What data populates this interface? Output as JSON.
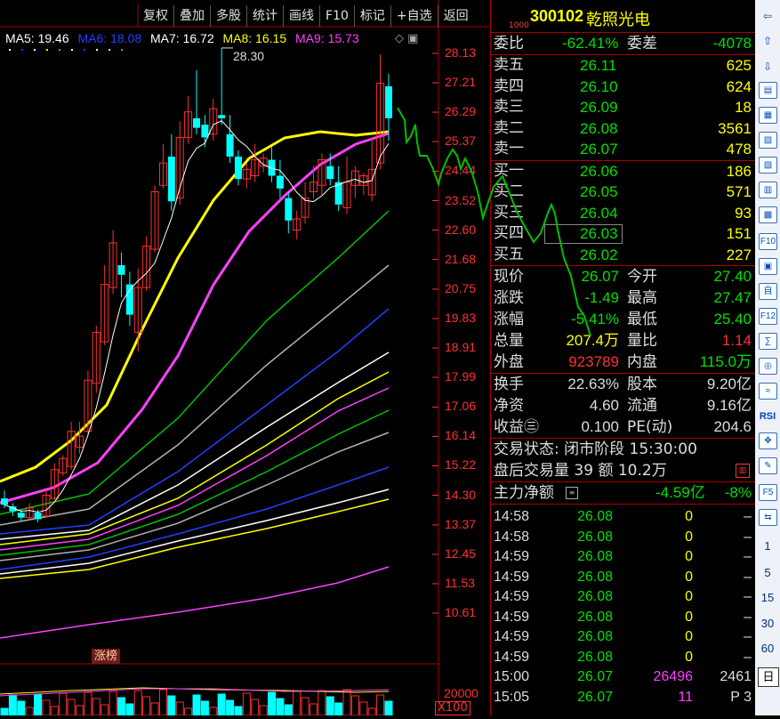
{
  "toolbar": [
    "复权",
    "叠加",
    "多股",
    "统计",
    "画线",
    "F10",
    "标记",
    "+自选",
    "返回"
  ],
  "ma_legend": [
    {
      "label": "MA5: 19.46",
      "color": "#ffffff"
    },
    {
      "label": "MA6: 18.08",
      "color": "#2040ff"
    },
    {
      "label": "MA7: 16.72",
      "color": "#ffffff"
    },
    {
      "label": "MA8: 16.15",
      "color": "#ffff00"
    },
    {
      "label": "MA9: 15.73",
      "color": "#ff40ff"
    }
  ],
  "chart_data": {
    "type": "candlestick",
    "y_ticks": [
      "28.13",
      "27.21",
      "26.29",
      "25.37",
      "24.44",
      "23.52",
      "22.60",
      "21.68",
      "20.75",
      "19.83",
      "18.91",
      "17.99",
      "17.06",
      "16.14",
      "15.22",
      "14.30",
      "13.37",
      "12.45",
      "11.53",
      "10.61"
    ],
    "high_label": "28.30",
    "badge": "涨榜",
    "volume_tick": "20000",
    "volume_unit": "X100",
    "up_color": "#ff3030",
    "down_color": "#00ffff",
    "candles": [
      {
        "o": 14.2,
        "c": 14.0,
        "h": 14.45,
        "l": 13.9
      },
      {
        "o": 13.95,
        "c": 13.8,
        "h": 14.05,
        "l": 13.65
      },
      {
        "o": 13.75,
        "c": 13.6,
        "h": 13.85,
        "l": 13.5
      },
      {
        "o": 13.6,
        "c": 13.9,
        "h": 14.05,
        "l": 13.55
      },
      {
        "o": 13.75,
        "c": 13.55,
        "h": 13.85,
        "l": 13.45
      },
      {
        "o": 13.65,
        "c": 14.3,
        "h": 14.45,
        "l": 13.6
      },
      {
        "o": 14.2,
        "c": 15.1,
        "h": 15.3,
        "l": 14.15
      },
      {
        "o": 15.0,
        "c": 15.45,
        "h": 15.55,
        "l": 14.9
      },
      {
        "o": 15.2,
        "c": 16.3,
        "h": 16.6,
        "l": 15.1
      },
      {
        "o": 15.8,
        "c": 16.15,
        "h": 16.6,
        "l": 15.6
      },
      {
        "o": 16.3,
        "c": 17.9,
        "h": 18.2,
        "l": 16.2
      },
      {
        "o": 17.8,
        "c": 19.4,
        "h": 19.6,
        "l": 17.5
      },
      {
        "o": 19.1,
        "c": 20.9,
        "h": 21.5,
        "l": 19.0
      },
      {
        "o": 20.8,
        "c": 22.2,
        "h": 22.6,
        "l": 20.6
      },
      {
        "o": 21.5,
        "c": 21.2,
        "h": 21.9,
        "l": 20.5
      },
      {
        "o": 20.9,
        "c": 19.95,
        "h": 21.3,
        "l": 19.6
      },
      {
        "o": 19.4,
        "c": 20.8,
        "h": 21.4,
        "l": 18.8
      },
      {
        "o": 20.8,
        "c": 22.1,
        "h": 22.4,
        "l": 20.7
      },
      {
        "o": 22.0,
        "c": 23.8,
        "h": 24.0,
        "l": 21.9
      },
      {
        "o": 24.0,
        "c": 24.7,
        "h": 25.3,
        "l": 23.9
      },
      {
        "o": 24.9,
        "c": 23.5,
        "h": 25.6,
        "l": 23.2
      },
      {
        "o": 23.6,
        "c": 25.5,
        "h": 26.0,
        "l": 23.4
      },
      {
        "o": 25.5,
        "c": 26.3,
        "h": 26.8,
        "l": 25.3
      },
      {
        "o": 26.1,
        "c": 25.8,
        "h": 27.6,
        "l": 25.6
      },
      {
        "o": 25.9,
        "c": 25.5,
        "h": 26.2,
        "l": 25.2
      },
      {
        "o": 25.6,
        "c": 26.4,
        "h": 26.7,
        "l": 25.4
      },
      {
        "o": 26.2,
        "c": 26.1,
        "h": 28.3,
        "l": 25.9
      },
      {
        "o": 25.6,
        "c": 24.9,
        "h": 26.2,
        "l": 24.7
      },
      {
        "o": 24.9,
        "c": 24.2,
        "h": 25.1,
        "l": 24.0
      },
      {
        "o": 24.2,
        "c": 24.5,
        "h": 24.7,
        "l": 23.9
      },
      {
        "o": 24.3,
        "c": 24.8,
        "h": 25.3,
        "l": 24.1
      },
      {
        "o": 24.6,
        "c": 24.85,
        "h": 25.0,
        "l": 24.4
      },
      {
        "o": 24.8,
        "c": 24.3,
        "h": 25.2,
        "l": 24.1
      },
      {
        "o": 24.3,
        "c": 23.9,
        "h": 24.8,
        "l": 23.6
      },
      {
        "o": 23.6,
        "c": 22.9,
        "h": 23.8,
        "l": 22.5
      },
      {
        "o": 22.6,
        "c": 22.95,
        "h": 23.2,
        "l": 22.3
      },
      {
        "o": 23.0,
        "c": 23.6,
        "h": 24.1,
        "l": 22.8
      },
      {
        "o": 23.8,
        "c": 24.1,
        "h": 24.6,
        "l": 23.6
      },
      {
        "o": 24.0,
        "c": 24.8,
        "h": 25.0,
        "l": 23.7
      },
      {
        "o": 24.6,
        "c": 24.2,
        "h": 25.0,
        "l": 24.0
      },
      {
        "o": 24.1,
        "c": 23.4,
        "h": 24.6,
        "l": 23.2
      },
      {
        "o": 23.3,
        "c": 24.1,
        "h": 24.9,
        "l": 23.1
      },
      {
        "o": 24.0,
        "c": 24.45,
        "h": 24.6,
        "l": 23.6
      },
      {
        "o": 24.0,
        "c": 24.3,
        "h": 24.4,
        "l": 23.7
      },
      {
        "o": 23.7,
        "c": 24.5,
        "h": 25.5,
        "l": 23.5
      },
      {
        "o": 24.7,
        "c": 27.2,
        "h": 28.1,
        "l": 24.5
      },
      {
        "o": 27.1,
        "c": 26.1,
        "h": 27.5,
        "l": 25.4
      }
    ]
  },
  "quote": {
    "code": "300102",
    "name": "乾照光电",
    "tiny": "1000",
    "weibi_label": "委比",
    "weibi": "-62.41%",
    "weicha_label": "委差",
    "weicha": "-4078",
    "asks": [
      {
        "label": "卖五",
        "price": "26.11",
        "vol": "625"
      },
      {
        "label": "卖四",
        "price": "26.10",
        "vol": "624"
      },
      {
        "label": "卖三",
        "price": "26.09",
        "vol": "18"
      },
      {
        "label": "卖二",
        "price": "26.08",
        "vol": "3561"
      },
      {
        "label": "卖一",
        "price": "26.07",
        "vol": "478"
      }
    ],
    "bids": [
      {
        "label": "买一",
        "price": "26.06",
        "vol": "186"
      },
      {
        "label": "买二",
        "price": "26.05",
        "vol": "571"
      },
      {
        "label": "买三",
        "price": "26.04",
        "vol": "93"
      },
      {
        "label": "买四",
        "price": "26.03",
        "vol": "151"
      },
      {
        "label": "买五",
        "price": "26.02",
        "vol": "227"
      }
    ],
    "stats": [
      {
        "l1": "现价",
        "v1": "26.07",
        "c1": "g",
        "l2": "今开",
        "v2": "27.40",
        "c2": "g"
      },
      {
        "l1": "涨跌",
        "v1": "-1.49",
        "c1": "g",
        "l2": "最高",
        "v2": "27.47",
        "c2": "g"
      },
      {
        "l1": "涨幅",
        "v1": "-5.41%",
        "c1": "g",
        "l2": "最低",
        "v2": "25.40",
        "c2": "g"
      },
      {
        "l1": "总量",
        "v1": "207.4万",
        "c1": "y",
        "l2": "量比",
        "v2": "1.14",
        "c2": "r"
      },
      {
        "l1": "外盘",
        "v1": "923789",
        "c1": "r",
        "l2": "内盘",
        "v2": "115.0万",
        "c2": "g"
      }
    ],
    "fin": [
      {
        "l1": "换手",
        "v1": "22.63%",
        "l2": "股本",
        "v2": "9.20亿"
      },
      {
        "l1": "净资",
        "v1": "4.60",
        "l2": "流通",
        "v2": "9.16亿"
      },
      {
        "l1": "收益㊂",
        "v1": "0.100",
        "l2": "PE(动)",
        "v2": "204.6"
      }
    ],
    "status_label": "交易状态: 闭市阶段 15:30:00",
    "after_label": "盘后交易量 39 额 10.2万",
    "main_label": "主力净额",
    "main_value": "-4.59亿",
    "main_pct": "-8%"
  },
  "ticks": [
    {
      "t": "14:58",
      "p": "26.08",
      "v": "0",
      "f": "–",
      "vc": "y"
    },
    {
      "t": "14:58",
      "p": "26.08",
      "v": "0",
      "f": "–",
      "vc": "y"
    },
    {
      "t": "14:59",
      "p": "26.08",
      "v": "0",
      "f": "–",
      "vc": "y"
    },
    {
      "t": "14:59",
      "p": "26.08",
      "v": "0",
      "f": "–",
      "vc": "y"
    },
    {
      "t": "14:59",
      "p": "26.08",
      "v": "0",
      "f": "–",
      "vc": "y"
    },
    {
      "t": "14:59",
      "p": "26.08",
      "v": "0",
      "f": "–",
      "vc": "y"
    },
    {
      "t": "14:59",
      "p": "26.08",
      "v": "0",
      "f": "–",
      "vc": "y"
    },
    {
      "t": "14:59",
      "p": "26.08",
      "v": "0",
      "f": "–",
      "vc": "y"
    },
    {
      "t": "15:00",
      "p": "26.07",
      "v": "26496",
      "f": "2461",
      "vc": "m"
    },
    {
      "t": "15:05",
      "p": "26.07",
      "v": "11",
      "f": "P  3",
      "vc": "m"
    }
  ],
  "sidebar": [
    "⇦",
    "⇧",
    "⇩",
    "▤",
    "▦",
    "▧",
    "▨",
    "▥",
    "▩",
    "F10",
    "▣",
    "自",
    "F12",
    "∑",
    "◎",
    "≈",
    "RSI",
    "✥",
    "✎",
    "F5",
    "⇆",
    "1",
    "5",
    "15",
    "30",
    "60",
    "日"
  ]
}
